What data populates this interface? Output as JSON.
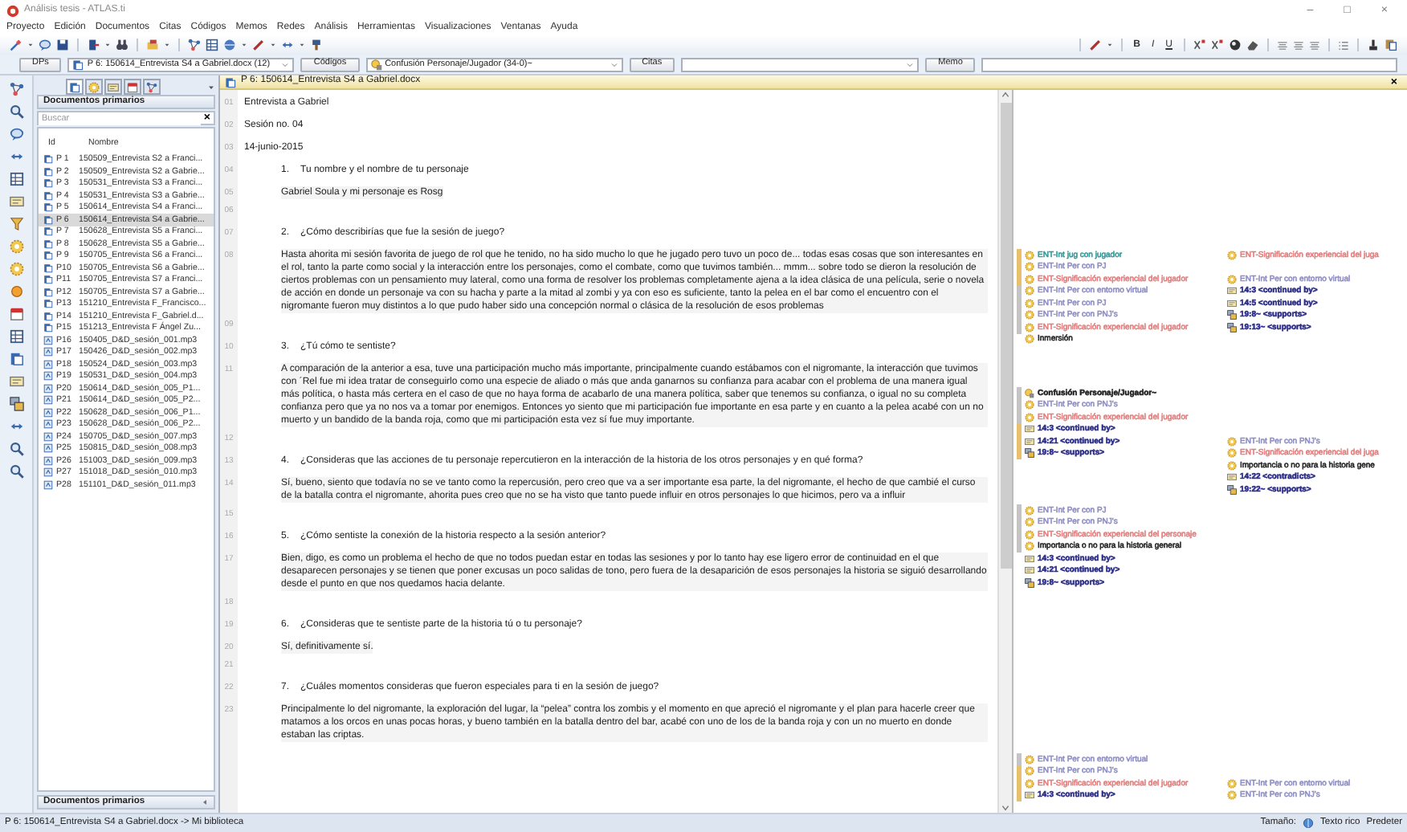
{
  "window": {
    "title": "Análisis tesis - ATLAS.ti",
    "controls": [
      "–",
      "□",
      "×"
    ]
  },
  "menu": [
    "Proyecto",
    "Edición",
    "Documentos",
    "Citas",
    "Códigos",
    "Memos",
    "Redes",
    "Análisis",
    "Herramientas",
    "Visualizaciones",
    "Ventanas",
    "Ayuda"
  ],
  "format_buttons": [
    "B",
    "I",
    "U"
  ],
  "selectors": [
    {
      "button": "DPs",
      "kind": "document",
      "value": "P 6: 150614_Entrevista S4 a Gabriel.docx (12)"
    },
    {
      "button": "Códigos",
      "kind": "code",
      "value": "Confusión Personaje/Jugador (34-0)~"
    },
    {
      "button": "Citas",
      "kind": "plain"
    },
    {
      "button": "Memo",
      "kind": "field"
    }
  ],
  "panel": {
    "tabs": [
      {
        "selected": true
      },
      {
        "selected": false
      },
      {
        "selected": false
      },
      {
        "selected": false
      },
      {
        "selected": false
      }
    ],
    "title": "Documentos primarios",
    "search": {
      "placeholder": "Buscar",
      "clear": "×"
    },
    "columns": [
      "Id",
      "Nombre"
    ],
    "rows": [
      {
        "id": "P 1",
        "name": "150509_Entrevista S2 a Franci...",
        "kind": "document",
        "selected": false
      },
      {
        "id": "P 2",
        "name": "150509_Entrevista S2 a Gabrie...",
        "kind": "document",
        "selected": false
      },
      {
        "id": "P 3",
        "name": "150531_Entrevista S3 a Franci...",
        "kind": "document",
        "selected": false
      },
      {
        "id": "P 4",
        "name": "150531_Entrevista S3 a Gabrie...",
        "kind": "document",
        "selected": false
      },
      {
        "id": "P 5",
        "name": "150614_Entrevista S4 a Franci...",
        "kind": "document",
        "selected": false
      },
      {
        "id": "P 6",
        "name": "150614_Entrevista S4 a Gabrie...",
        "kind": "document",
        "selected": true
      },
      {
        "id": "P 7",
        "name": "150628_Entrevista S5 a Franci...",
        "kind": "document",
        "selected": false
      },
      {
        "id": "P 8",
        "name": "150628_Entrevista S5 a Gabrie...",
        "kind": "document",
        "selected": false
      },
      {
        "id": "P 9",
        "name": "150705_Entrevista S6 a Franci...",
        "kind": "document",
        "selected": false
      },
      {
        "id": "P10",
        "name": "150705_Entrevista S6 a Gabrie...",
        "kind": "document",
        "selected": false
      },
      {
        "id": "P11",
        "name": "150705_Entrevista S7 a Franci...",
        "kind": "document",
        "selected": false
      },
      {
        "id": "P12",
        "name": "150705_Entrevista S7 a Gabrie...",
        "kind": "document",
        "selected": false
      },
      {
        "id": "P13",
        "name": "151210_Entrevista F_Francisco...",
        "kind": "document",
        "selected": false
      },
      {
        "id": "P14",
        "name": "151210_Entrevista F_Gabriel.d...",
        "kind": "document",
        "selected": false
      },
      {
        "id": "P15",
        "name": "151213_Entrevista F Ángel Zu...",
        "kind": "document",
        "selected": false
      },
      {
        "id": "P16",
        "name": "150405_D&D_sesión_001.mp3",
        "kind": "audio",
        "selected": false
      },
      {
        "id": "P17",
        "name": "150426_D&D_sesión_002.mp3",
        "kind": "audio",
        "selected": false
      },
      {
        "id": "P18",
        "name": "150524_D&D_sesión_003.mp3",
        "kind": "audio",
        "selected": false
      },
      {
        "id": "P19",
        "name": "150531_D&D_sesión_004.mp3",
        "kind": "audio",
        "selected": false
      },
      {
        "id": "P20",
        "name": "150614_D&D_sesión_005_P1...",
        "kind": "audio",
        "selected": false
      },
      {
        "id": "P21",
        "name": "150614_D&D_sesión_005_P2...",
        "kind": "audio",
        "selected": false
      },
      {
        "id": "P22",
        "name": "150628_D&D_sesión_006_P1...",
        "kind": "audio",
        "selected": false
      },
      {
        "id": "P23",
        "name": "150628_D&D_sesión_006_P2...",
        "kind": "audio",
        "selected": false
      },
      {
        "id": "P24",
        "name": "150705_D&D_sesión_007.mp3",
        "kind": "audio",
        "selected": false
      },
      {
        "id": "P25",
        "name": "150815_D&D_sesión_008.mp3",
        "kind": "audio",
        "selected": false
      },
      {
        "id": "P26",
        "name": "151003_D&D_sesión_009.mp3",
        "kind": "audio",
        "selected": false
      },
      {
        "id": "P27",
        "name": "151018_D&D_sesión_010.mp3",
        "kind": "audio",
        "selected": false
      },
      {
        "id": "P28",
        "name": "151101_D&D_sesión_011.mp3",
        "kind": "audio",
        "selected": false
      }
    ],
    "footer": "Documentos primarios"
  },
  "document": {
    "title": "P 6: 150614_Entrevista S4 a Gabriel.docx",
    "close": "×",
    "lines": [
      {
        "number": "01",
        "kind": "plain",
        "text": "Entrevista a Gabriel"
      },
      {
        "number": "02",
        "kind": "plain",
        "text": "Sesión no. 04"
      },
      {
        "number": "03",
        "kind": "plain",
        "text": "14-junio-2015"
      },
      {
        "number": "04",
        "kind": "question",
        "marker": "1.",
        "text": "Tu nombre y el nombre de tu personaje"
      },
      {
        "number": "05",
        "kind": "answer",
        "text": "Gabriel Soula y mi personaje es Rosg"
      },
      {
        "number": "06",
        "kind": "blank"
      },
      {
        "number": "07",
        "kind": "question",
        "marker": "2.",
        "text": "¿Cómo describirías que fue la sesión de juego?"
      },
      {
        "number": "08",
        "kind": "answer",
        "text": "Hasta ahorita mi sesión favorita de juego de rol que he tenido, no ha sido mucho lo que he jugado pero tuvo un poco de... todas esas cosas que son interesantes en el rol, tanto la parte como social y la interacción entre los personajes, como el combate, como que tuvimos también... mmm... sobre todo se dieron la resolución de ciertos problemas con un pensamiento muy lateral, como una forma de resolver los problemas completamente ajena a la idea clásica de una película, serie o novela de acción en donde un personaje va con su hacha y parte a la mitad al zombi y ya con eso es suficiente, tanto la pelea en el bar como el encuentro con el nigromante fueron muy distintos a lo que pudo haber sido una concepción normal o clásica de la resolución de esos problemas"
      },
      {
        "number": "09",
        "kind": "blank"
      },
      {
        "number": "10",
        "kind": "question",
        "marker": "3.",
        "text": "¿Tú cómo te sentiste?"
      },
      {
        "number": "11",
        "kind": "answer",
        "text": "A comparación de la anterior a esa, tuve una participación mucho más importante, principalmente cuando estábamos con el nigromante, la interacción que tuvimos con ´Rel fue mi idea tratar de conseguirlo como una especie de aliado o más que anda ganarnos su confianza para acabar con el problema de una manera igual más política, o hasta más certera en el caso de que no haya forma de acabarlo de una manera política, saber que tenemos su confianza, o igual no su completa confianza pero que ya no nos va a tomar por enemigos. Entonces yo siento que mi participación fue importante en esa parte y en cuanto a la pelea acabé con un no muerto y un bandido de la banda roja, como que mi participación esta vez sí fue muy importante."
      },
      {
        "number": "12",
        "kind": "blank"
      },
      {
        "number": "13",
        "kind": "question",
        "marker": "4.",
        "text": "¿Consideras que las acciones de tu personaje repercutieron en la interacción de la historia de los otros personajes y en qué forma?"
      },
      {
        "number": "14",
        "kind": "answer",
        "text": "Sí, bueno, siento que todavía no se ve tanto como la repercusión, pero creo que va a ser importante esa parte, la del nigromante, el hecho de que cambié el curso de la batalla contra el nigromante, ahorita pues creo que no se ha visto que tanto puede influir en otros personajes lo que hicimos, pero va a influir"
      },
      {
        "number": "15",
        "kind": "blank"
      },
      {
        "number": "16",
        "kind": "question",
        "marker": "5.",
        "text": "¿Cómo sentiste la conexión de la historia respecto a la sesión anterior?"
      },
      {
        "number": "17",
        "kind": "answer",
        "text": "Bien, digo, es como un problema el hecho de que no todos puedan estar en todas las sesiones y por lo tanto hay ese ligero error de continuidad en el que desaparecen personajes y se tienen que poner excusas un poco salidas de tono, pero fuera de la desaparición de esos personajes la historia se siguió desarrollando desde el punto en que nos quedamos hacia delante."
      },
      {
        "number": "18",
        "kind": "blank"
      },
      {
        "number": "19",
        "kind": "question",
        "marker": "6.",
        "text": "¿Consideras que te sentiste parte de la historia tú o tu personaje?"
      },
      {
        "number": "20",
        "kind": "answer",
        "text": "Sí, definitivamente sí."
      },
      {
        "number": "21",
        "kind": "blank"
      },
      {
        "number": "22",
        "kind": "question",
        "marker": "7.",
        "text": "¿Cuáles momentos consideras que fueron especiales para ti en la sesión de juego?"
      },
      {
        "number": "23",
        "kind": "answer",
        "text": "Principalmente lo del nigromante, la exploración del lugar, la “pelea” contra los zombis y el momento en que apreció el nigromante y el plan para hacerle creer que matamos a los orcos en unas pocas horas, y bueno también en la batalla dentro del bar, acabé con uno de los de la banda roja y con un no muerto en donde estaban las criptas."
      }
    ]
  },
  "margin_groups": [
    {
      "rows": [
        {
          "color": "#e8bf6a",
          "left": {
            "kind": "code",
            "text": "ENT-Int jug con jugador",
            "color": "#2e9a9a"
          },
          "right": {
            "kind": "code",
            "text": "ENT-Significación experiencial del juga",
            "color": "#e87a7a"
          }
        },
        {
          "color": "#e8bf6a",
          "left": {
            "kind": "code",
            "text": "ENT-Int Per con PJ",
            "color": "#8e8ec8"
          }
        },
        {
          "color": "#e8bf6a",
          "left": {
            "kind": "code",
            "text": "ENT-Significación experiencial del jugador",
            "color": "#e87a7a"
          },
          "right": {
            "kind": "code",
            "text": "ENT-Int Per con entorno virtual",
            "color": "#8e8ec8"
          }
        },
        {
          "color": "#c4c4c4",
          "left": {
            "kind": "code",
            "text": "ENT-Int Per con entorno virtual",
            "color": "#8e8ec8"
          },
          "right": {
            "kind": "quote",
            "text": "14:3 <continued by>",
            "color": "#2c2c8c"
          }
        },
        {
          "color": "#c4c4c4",
          "left": {
            "kind": "code",
            "text": "ENT-Int Per con PJ",
            "color": "#8e8ec8"
          },
          "right": {
            "kind": "quote",
            "text": "14:5 <continued by>",
            "color": "#2c2c8c"
          }
        },
        {
          "color": "#c4c4c4",
          "left": {
            "kind": "code",
            "text": "ENT-Int Per con PNJ's",
            "color": "#8e8ec8"
          },
          "right": {
            "kind": "link",
            "text": "19:8~ <supports>",
            "color": "#2c2c8c"
          }
        },
        {
          "color": "#c4c4c4",
          "left": {
            "kind": "code",
            "text": "ENT-Significación experiencial del jugador",
            "color": "#e87a7a"
          },
          "right": {
            "kind": "link",
            "text": "19:13~ <supports>",
            "color": "#2c2c8c"
          }
        },
        {
          "left": {
            "kind": "code",
            "text": "Inmersión",
            "color": "#222222"
          }
        }
      ]
    },
    {
      "rows": [
        {
          "color": "#c4c4c4",
          "left": {
            "kind": "group",
            "text": "Confusión Personaje/Jugador~",
            "color": "#222222"
          }
        },
        {
          "color": "#c4c4c4",
          "left": {
            "kind": "code",
            "text": "ENT-Int Per con PNJ's",
            "color": "#8e8ec8"
          }
        },
        {
          "color": "#c4c4c4",
          "left": {
            "kind": "code",
            "text": "ENT-Significación experiencial del jugador",
            "color": "#e87a7a"
          }
        },
        {
          "color": "#e8bf6a",
          "left": {
            "kind": "quote",
            "text": "14:3 <continued by>",
            "color": "#2c2c8c"
          }
        },
        {
          "color": "#e8bf6a",
          "left": {
            "kind": "quote",
            "text": "14:21 <continued by>",
            "color": "#2c2c8c"
          },
          "right": {
            "kind": "code",
            "text": "ENT-Int Per con PNJ's",
            "color": "#8e8ec8"
          }
        },
        {
          "color": "#e8bf6a",
          "left": {
            "kind": "link",
            "text": "19:8~ <supports>",
            "color": "#2c2c8c"
          },
          "right": {
            "kind": "code",
            "text": "ENT-Significación experiencial del juga",
            "color": "#e87a7a"
          }
        },
        {
          "right": {
            "kind": "code",
            "text": "Importancia o no para la historia gene",
            "color": "#222222"
          }
        },
        {
          "right": {
            "kind": "quote",
            "text": "14:22 <contradicts>",
            "color": "#2c2c8c"
          }
        },
        {
          "right": {
            "kind": "link",
            "text": "19:22~ <supports>",
            "color": "#2c2c8c"
          }
        }
      ]
    },
    {
      "rows": [
        {
          "color": "#c4c4c4",
          "left": {
            "kind": "code",
            "text": "ENT-Int Per con PJ",
            "color": "#8e8ec8"
          }
        },
        {
          "color": "#c4c4c4",
          "left": {
            "kind": "code",
            "text": "ENT-Int Per con PNJ's",
            "color": "#8e8ec8"
          }
        },
        {
          "color": "#c4c4c4",
          "left": {
            "kind": "code",
            "text": "ENT-Significación experiencial del personaje",
            "color": "#e87a7a"
          }
        },
        {
          "color": "#c4c4c4",
          "left": {
            "kind": "code",
            "text": "Importancia o no para la historia general",
            "color": "#222222"
          }
        },
        {
          "left": {
            "kind": "quote",
            "text": "14:3 <continued by>",
            "color": "#2c2c8c"
          }
        },
        {
          "left": {
            "kind": "quote",
            "text": "14:21 <continued by>",
            "color": "#2c2c8c"
          }
        },
        {
          "left": {
            "kind": "link",
            "text": "19:8~ <supports>",
            "color": "#2c2c8c"
          }
        }
      ]
    },
    {
      "rows": [
        {
          "color": "#c4c4c4",
          "left": {
            "kind": "code",
            "text": "ENT-Int Per con entorno virtual",
            "color": "#8e8ec8"
          }
        },
        {
          "color": "#e8bf6a",
          "left": {
            "kind": "code",
            "text": "ENT-Int Per con PNJ's",
            "color": "#8e8ec8"
          }
        },
        {
          "color": "#e8bf6a",
          "left": {
            "kind": "code",
            "text": "ENT-Significación experiencial del jugador",
            "color": "#e87a7a"
          },
          "right": {
            "kind": "code",
            "text": "ENT-Int Per con entorno virtual",
            "color": "#8e8ec8"
          }
        },
        {
          "color": "#e8bf6a",
          "left": {
            "kind": "quote",
            "text": "14:3 <continued by>",
            "color": "#2c2c8c"
          },
          "right": {
            "kind": "code",
            "text": "ENT-Int Per con PNJ's",
            "color": "#8e8ec8"
          }
        }
      ]
    }
  ],
  "status_bar": {
    "path": "P 6: 150614_Entrevista S4 a Gabriel.docx -> Mi biblioteca",
    "size_label": "Tamaño:",
    "format": "Texto rico",
    "style": "Predeter"
  }
}
